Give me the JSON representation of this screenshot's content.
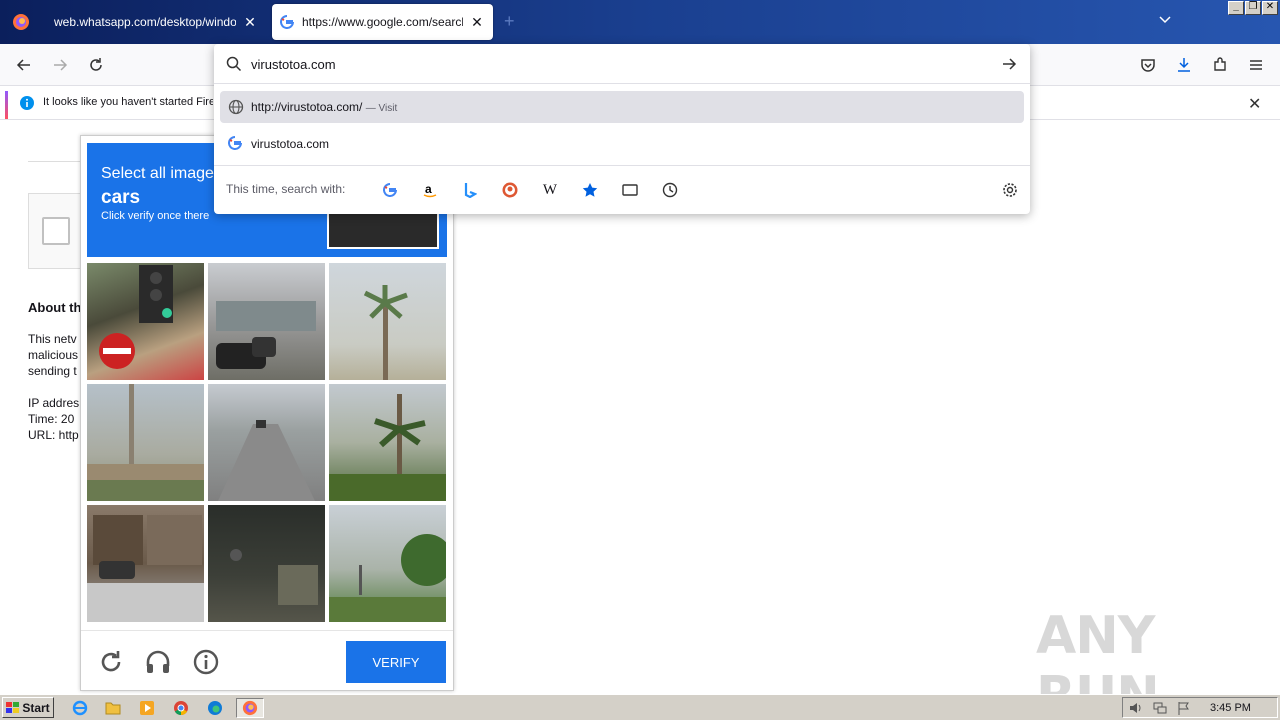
{
  "browser": {
    "tabs": [
      {
        "title": "web.whatsapp.com/desktop/windows/r",
        "favicon": "firefox-icon"
      },
      {
        "title": "https://www.google.com/search?q",
        "favicon": "google-icon",
        "active": true
      }
    ],
    "new_tab": "+"
  },
  "urlbar": {
    "query": "virustotoa.com",
    "suggestions": [
      {
        "text": "http://virustotoa.com/",
        "action": "— Visit",
        "icon": "globe-icon"
      },
      {
        "text": "virustotoa.com",
        "icon": "google-icon"
      }
    ],
    "search_with_label": "This time, search with:",
    "engines": [
      "google",
      "amazon",
      "bing",
      "duckduckgo",
      "wikipedia",
      "bookmarks",
      "tabs",
      "history"
    ]
  },
  "infobar": {
    "text": "It looks like you haven't started Fire"
  },
  "page": {
    "about_heading": "About th",
    "para1": [
      "This netv",
      "malicious",
      "sending t"
    ],
    "para2": [
      "IP addres",
      "Time: 20",
      "URL: http"
    ]
  },
  "captcha": {
    "line1": "Select all image",
    "line2": "cars",
    "line3": "Click verify once there",
    "verify_label": "VERIFY"
  },
  "watermark": "ANY RUN",
  "taskbar": {
    "start_label": "Start",
    "clock": "3:45 PM"
  },
  "colors": {
    "captcha_blue": "#1a73e8",
    "titlebar": "#1a3f8f"
  }
}
